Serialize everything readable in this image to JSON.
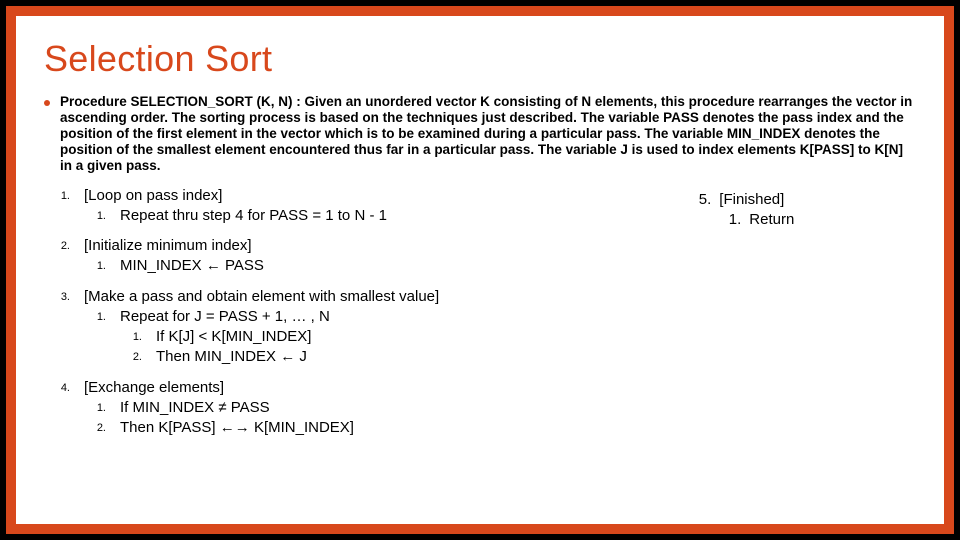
{
  "title": "Selection Sort",
  "intro": "Procedure SELECTION_SORT (K, N) : Given an unordered vector K consisting of N elements, this procedure rearranges the vector in ascending order. The sorting process is based on the techniques just described. The variable PASS denotes the pass index and the position of the first element in the vector which is to be examined during a particular pass. The variable MIN_INDEX denotes the position of the smallest element encountered thus far in a particular pass. The variable J is used to index elements K[PASS] to K[N] in a given pass.",
  "steps": {
    "s1": {
      "num": "1.",
      "title": "[Loop on pass index]",
      "sub1num": "1.",
      "sub1": "Repeat thru step 4 for PASS = 1 to N - 1"
    },
    "s2": {
      "num": "2.",
      "title": "[Initialize minimum index]",
      "sub1num": "1.",
      "sub1": "MIN_INDEX ← PASS"
    },
    "s3": {
      "num": "3.",
      "title": "[Make a pass and obtain element with smallest value]",
      "sub1num": "1.",
      "sub1": "Repeat for J = PASS + 1, … , N",
      "ss1num": "1.",
      "ss1": "If K[J] < K[MIN_INDEX]",
      "ss2num": "2.",
      "ss2": "Then MIN_INDEX ← J"
    },
    "s4": {
      "num": "4.",
      "title": "[Exchange elements]",
      "sub1num": "1.",
      "sub1": "If MIN_INDEX ≠ PASS",
      "sub2num": "2.",
      "sub2": "Then K[PASS] ←→ K[MIN_INDEX]"
    },
    "s5": {
      "num": "5.",
      "title": "[Finished]",
      "sub1num": "1.",
      "sub1": "Return"
    }
  }
}
